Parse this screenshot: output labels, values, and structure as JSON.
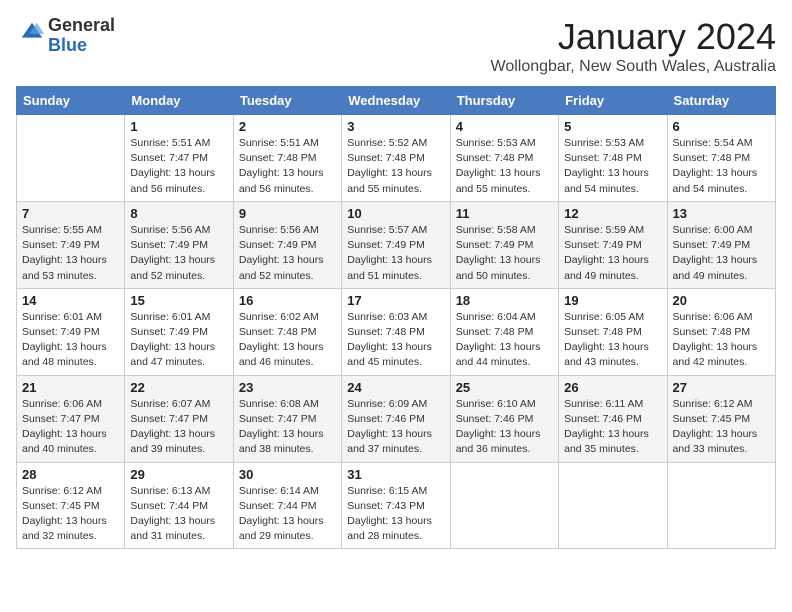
{
  "header": {
    "logo_general": "General",
    "logo_blue": "Blue",
    "month": "January 2024",
    "location": "Wollongbar, New South Wales, Australia"
  },
  "days": [
    "Sunday",
    "Monday",
    "Tuesday",
    "Wednesday",
    "Thursday",
    "Friday",
    "Saturday"
  ],
  "weeks": [
    [
      {
        "date": "",
        "sunrise": "",
        "sunset": "",
        "daylight": ""
      },
      {
        "date": "1",
        "sunrise": "Sunrise: 5:51 AM",
        "sunset": "Sunset: 7:47 PM",
        "daylight": "Daylight: 13 hours and 56 minutes."
      },
      {
        "date": "2",
        "sunrise": "Sunrise: 5:51 AM",
        "sunset": "Sunset: 7:48 PM",
        "daylight": "Daylight: 13 hours and 56 minutes."
      },
      {
        "date": "3",
        "sunrise": "Sunrise: 5:52 AM",
        "sunset": "Sunset: 7:48 PM",
        "daylight": "Daylight: 13 hours and 55 minutes."
      },
      {
        "date": "4",
        "sunrise": "Sunrise: 5:53 AM",
        "sunset": "Sunset: 7:48 PM",
        "daylight": "Daylight: 13 hours and 55 minutes."
      },
      {
        "date": "5",
        "sunrise": "Sunrise: 5:53 AM",
        "sunset": "Sunset: 7:48 PM",
        "daylight": "Daylight: 13 hours and 54 minutes."
      },
      {
        "date": "6",
        "sunrise": "Sunrise: 5:54 AM",
        "sunset": "Sunset: 7:48 PM",
        "daylight": "Daylight: 13 hours and 54 minutes."
      }
    ],
    [
      {
        "date": "7",
        "sunrise": "Sunrise: 5:55 AM",
        "sunset": "Sunset: 7:49 PM",
        "daylight": "Daylight: 13 hours and 53 minutes."
      },
      {
        "date": "8",
        "sunrise": "Sunrise: 5:56 AM",
        "sunset": "Sunset: 7:49 PM",
        "daylight": "Daylight: 13 hours and 52 minutes."
      },
      {
        "date": "9",
        "sunrise": "Sunrise: 5:56 AM",
        "sunset": "Sunset: 7:49 PM",
        "daylight": "Daylight: 13 hours and 52 minutes."
      },
      {
        "date": "10",
        "sunrise": "Sunrise: 5:57 AM",
        "sunset": "Sunset: 7:49 PM",
        "daylight": "Daylight: 13 hours and 51 minutes."
      },
      {
        "date": "11",
        "sunrise": "Sunrise: 5:58 AM",
        "sunset": "Sunset: 7:49 PM",
        "daylight": "Daylight: 13 hours and 50 minutes."
      },
      {
        "date": "12",
        "sunrise": "Sunrise: 5:59 AM",
        "sunset": "Sunset: 7:49 PM",
        "daylight": "Daylight: 13 hours and 49 minutes."
      },
      {
        "date": "13",
        "sunrise": "Sunrise: 6:00 AM",
        "sunset": "Sunset: 7:49 PM",
        "daylight": "Daylight: 13 hours and 49 minutes."
      }
    ],
    [
      {
        "date": "14",
        "sunrise": "Sunrise: 6:01 AM",
        "sunset": "Sunset: 7:49 PM",
        "daylight": "Daylight: 13 hours and 48 minutes."
      },
      {
        "date": "15",
        "sunrise": "Sunrise: 6:01 AM",
        "sunset": "Sunset: 7:49 PM",
        "daylight": "Daylight: 13 hours and 47 minutes."
      },
      {
        "date": "16",
        "sunrise": "Sunrise: 6:02 AM",
        "sunset": "Sunset: 7:48 PM",
        "daylight": "Daylight: 13 hours and 46 minutes."
      },
      {
        "date": "17",
        "sunrise": "Sunrise: 6:03 AM",
        "sunset": "Sunset: 7:48 PM",
        "daylight": "Daylight: 13 hours and 45 minutes."
      },
      {
        "date": "18",
        "sunrise": "Sunrise: 6:04 AM",
        "sunset": "Sunset: 7:48 PM",
        "daylight": "Daylight: 13 hours and 44 minutes."
      },
      {
        "date": "19",
        "sunrise": "Sunrise: 6:05 AM",
        "sunset": "Sunset: 7:48 PM",
        "daylight": "Daylight: 13 hours and 43 minutes."
      },
      {
        "date": "20",
        "sunrise": "Sunrise: 6:06 AM",
        "sunset": "Sunset: 7:48 PM",
        "daylight": "Daylight: 13 hours and 42 minutes."
      }
    ],
    [
      {
        "date": "21",
        "sunrise": "Sunrise: 6:06 AM",
        "sunset": "Sunset: 7:47 PM",
        "daylight": "Daylight: 13 hours and 40 minutes."
      },
      {
        "date": "22",
        "sunrise": "Sunrise: 6:07 AM",
        "sunset": "Sunset: 7:47 PM",
        "daylight": "Daylight: 13 hours and 39 minutes."
      },
      {
        "date": "23",
        "sunrise": "Sunrise: 6:08 AM",
        "sunset": "Sunset: 7:47 PM",
        "daylight": "Daylight: 13 hours and 38 minutes."
      },
      {
        "date": "24",
        "sunrise": "Sunrise: 6:09 AM",
        "sunset": "Sunset: 7:46 PM",
        "daylight": "Daylight: 13 hours and 37 minutes."
      },
      {
        "date": "25",
        "sunrise": "Sunrise: 6:10 AM",
        "sunset": "Sunset: 7:46 PM",
        "daylight": "Daylight: 13 hours and 36 minutes."
      },
      {
        "date": "26",
        "sunrise": "Sunrise: 6:11 AM",
        "sunset": "Sunset: 7:46 PM",
        "daylight": "Daylight: 13 hours and 35 minutes."
      },
      {
        "date": "27",
        "sunrise": "Sunrise: 6:12 AM",
        "sunset": "Sunset: 7:45 PM",
        "daylight": "Daylight: 13 hours and 33 minutes."
      }
    ],
    [
      {
        "date": "28",
        "sunrise": "Sunrise: 6:12 AM",
        "sunset": "Sunset: 7:45 PM",
        "daylight": "Daylight: 13 hours and 32 minutes."
      },
      {
        "date": "29",
        "sunrise": "Sunrise: 6:13 AM",
        "sunset": "Sunset: 7:44 PM",
        "daylight": "Daylight: 13 hours and 31 minutes."
      },
      {
        "date": "30",
        "sunrise": "Sunrise: 6:14 AM",
        "sunset": "Sunset: 7:44 PM",
        "daylight": "Daylight: 13 hours and 29 minutes."
      },
      {
        "date": "31",
        "sunrise": "Sunrise: 6:15 AM",
        "sunset": "Sunset: 7:43 PM",
        "daylight": "Daylight: 13 hours and 28 minutes."
      },
      {
        "date": "",
        "sunrise": "",
        "sunset": "",
        "daylight": ""
      },
      {
        "date": "",
        "sunrise": "",
        "sunset": "",
        "daylight": ""
      },
      {
        "date": "",
        "sunrise": "",
        "sunset": "",
        "daylight": ""
      }
    ]
  ]
}
